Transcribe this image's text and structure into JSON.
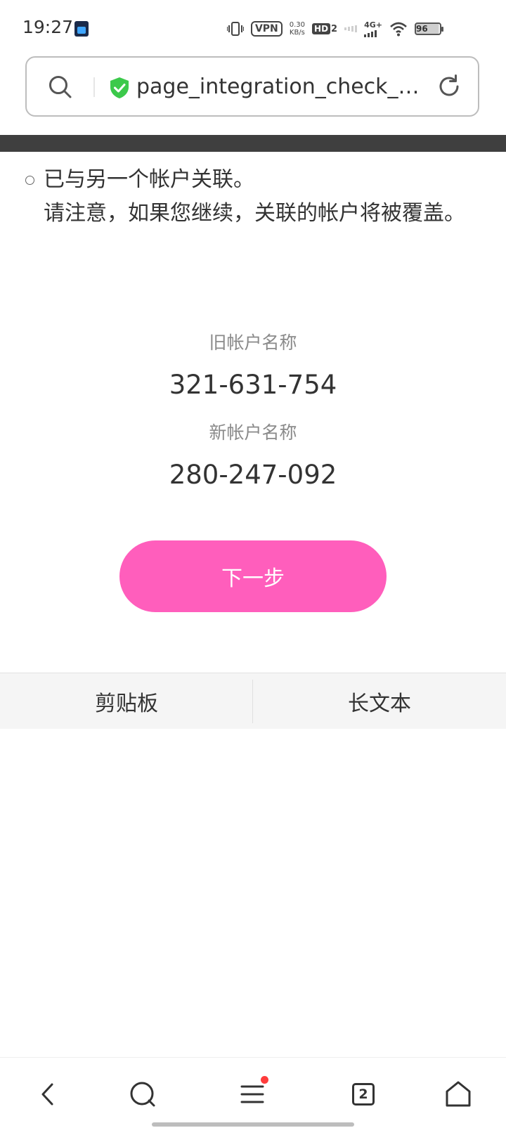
{
  "status_bar": {
    "time": "19:27",
    "vpn": "VPN",
    "speed_value": "0.30",
    "speed_unit": "KB/s",
    "hd": "HD",
    "hd_sub": "2",
    "network": "4G+",
    "battery": "96"
  },
  "url_bar": {
    "text": "page_integration_check_…",
    "secure_color": "#3cc94b"
  },
  "notice": {
    "line1": "已与另一个帐户关联。",
    "line2": "请注意，如果您继续，关联的帐户将被覆盖。"
  },
  "accounts": {
    "old_label": "旧帐户名称",
    "old_value": "321-631-754",
    "new_label": "新帐户名称",
    "new_value": "280-247-092"
  },
  "next_button": {
    "label": "下一步",
    "color": "#ff5ebc"
  },
  "tool_bar": {
    "clipboard": "剪贴板",
    "long_text": "长文本"
  },
  "bottom_nav": {
    "tabs_count": "2"
  }
}
